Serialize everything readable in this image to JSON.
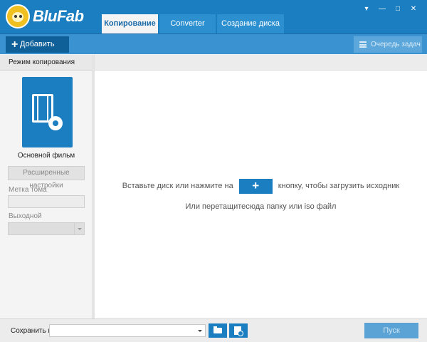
{
  "app": {
    "brand": "BluFab"
  },
  "tabs": [
    {
      "label": "Копирование",
      "active": true
    },
    {
      "label": "Converter",
      "active": false
    },
    {
      "label": "Создание диска",
      "active": false
    }
  ],
  "window_controls": {
    "menu": "▾",
    "minimize": "—",
    "maximize": "□",
    "close": "✕"
  },
  "toolbar": {
    "add_label": "Добавить",
    "queue_label": "Очередь задач"
  },
  "left_panel": {
    "header": "Режим копирования",
    "mode_label": "Основной фильм",
    "advanced_label": "Расширенные настройки",
    "volume_label": "Метка тома",
    "volume_value": "",
    "output_label": "Выходной",
    "output_value": ""
  },
  "main": {
    "hint_before": "Вставьте диск или нажмите на",
    "hint_after": "кнопку, чтобы загрузить исходник",
    "hint_drag": "Или перетащитесюда папку или iso файл"
  },
  "bottom": {
    "save_label": "Сохранить в:",
    "save_path": "",
    "start_label": "Пуск"
  },
  "colors": {
    "primary": "#1a7ec0",
    "toolbar": "#3a93d0",
    "dark_button": "#0f5f98"
  }
}
